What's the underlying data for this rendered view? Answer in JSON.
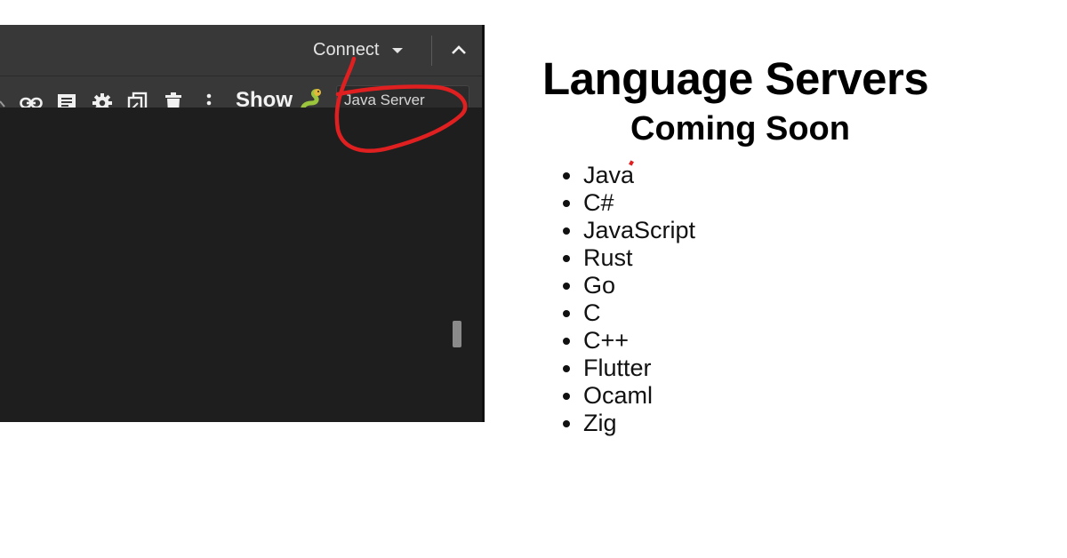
{
  "screenshot": {
    "connect_label": "Connect",
    "show_label": "Show",
    "server_input_value": "Java Server",
    "toolbar_icons": [
      "link-icon",
      "comment-icon",
      "gear-icon",
      "mirror-cell-icon",
      "trash-icon",
      "more-vert-icon"
    ],
    "colors": {
      "chrome": "#383838",
      "editor": "#1e1e1e",
      "annotation": "#e02020"
    }
  },
  "promo": {
    "title": "Language Servers",
    "subtitle": "Coming Soon",
    "languages": [
      "Java",
      "C#",
      "JavaScript",
      "Rust",
      "Go",
      "C",
      "C++",
      "Flutter",
      "Ocaml",
      "Zig"
    ]
  }
}
